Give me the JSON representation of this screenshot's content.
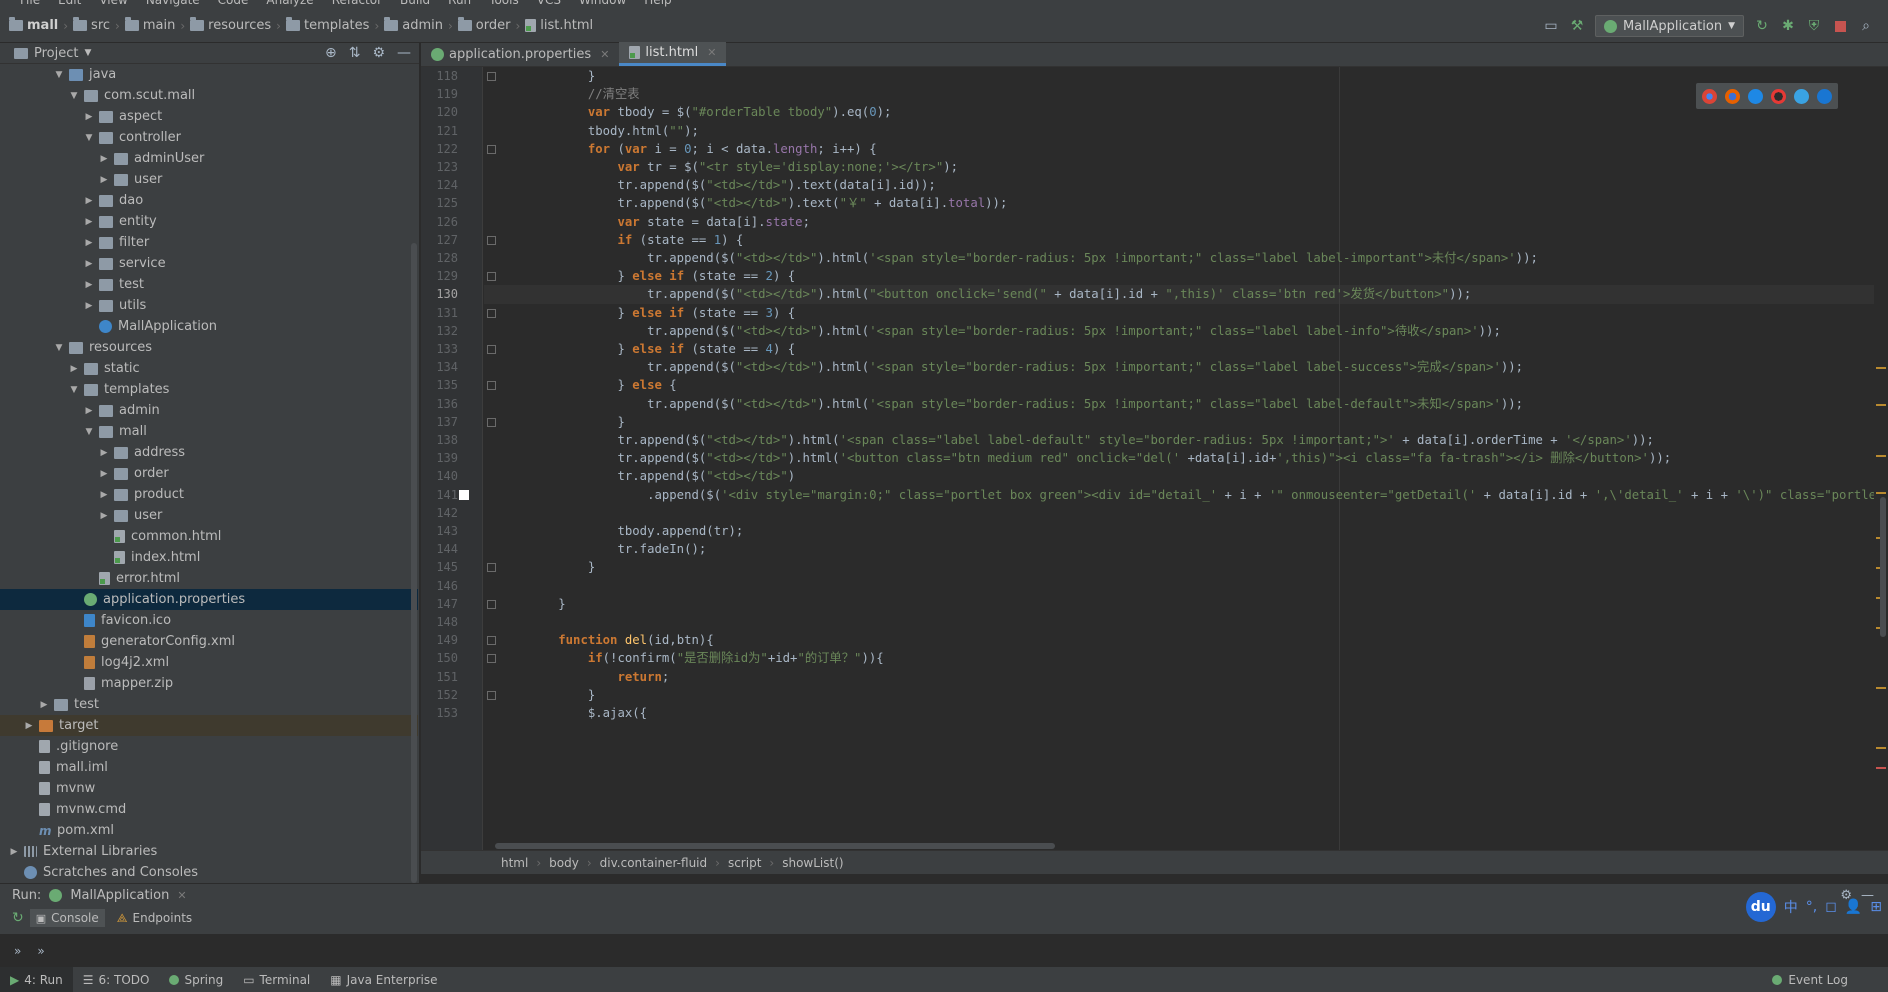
{
  "menu": [
    "File",
    "Edit",
    "View",
    "Navigate",
    "Code",
    "Analyze",
    "Refactor",
    "Build",
    "Run",
    "Tools",
    "VCS",
    "Window",
    "Help"
  ],
  "nav": {
    "breadcrumbs": [
      "mall",
      "src",
      "main",
      "resources",
      "templates",
      "admin",
      "order",
      "list.html"
    ],
    "run_config": "MallApplication"
  },
  "project": {
    "title": "Project",
    "tree": [
      {
        "label": "java",
        "depth": 3,
        "arrow": "open",
        "icon": "folder blue"
      },
      {
        "label": "com.scut.mall",
        "depth": 4,
        "arrow": "open",
        "icon": "folder"
      },
      {
        "label": "aspect",
        "depth": 5,
        "arrow": "closed",
        "icon": "folder"
      },
      {
        "label": "controller",
        "depth": 5,
        "arrow": "open",
        "icon": "folder"
      },
      {
        "label": "adminUser",
        "depth": 6,
        "arrow": "closed",
        "icon": "folder"
      },
      {
        "label": "user",
        "depth": 6,
        "arrow": "closed",
        "icon": "folder"
      },
      {
        "label": "dao",
        "depth": 5,
        "arrow": "closed",
        "icon": "folder"
      },
      {
        "label": "entity",
        "depth": 5,
        "arrow": "closed",
        "icon": "folder"
      },
      {
        "label": "filter",
        "depth": 5,
        "arrow": "closed",
        "icon": "folder"
      },
      {
        "label": "service",
        "depth": 5,
        "arrow": "closed",
        "icon": "folder"
      },
      {
        "label": "test",
        "depth": 5,
        "arrow": "closed",
        "icon": "folder"
      },
      {
        "label": "utils",
        "depth": 5,
        "arrow": "closed",
        "icon": "folder"
      },
      {
        "label": "MallApplication",
        "depth": 5,
        "arrow": "none",
        "icon": "cls"
      },
      {
        "label": "resources",
        "depth": 3,
        "arrow": "open",
        "icon": "folder"
      },
      {
        "label": "static",
        "depth": 4,
        "arrow": "closed",
        "icon": "folder"
      },
      {
        "label": "templates",
        "depth": 4,
        "arrow": "open",
        "icon": "folder"
      },
      {
        "label": "admin",
        "depth": 5,
        "arrow": "closed",
        "icon": "folder"
      },
      {
        "label": "mall",
        "depth": 5,
        "arrow": "open",
        "icon": "folder"
      },
      {
        "label": "address",
        "depth": 6,
        "arrow": "closed",
        "icon": "folder"
      },
      {
        "label": "order",
        "depth": 6,
        "arrow": "closed",
        "icon": "folder"
      },
      {
        "label": "product",
        "depth": 6,
        "arrow": "closed",
        "icon": "folder"
      },
      {
        "label": "user",
        "depth": 6,
        "arrow": "closed",
        "icon": "folder"
      },
      {
        "label": "common.html",
        "depth": 6,
        "arrow": "none",
        "icon": "file html"
      },
      {
        "label": "index.html",
        "depth": 6,
        "arrow": "none",
        "icon": "file html"
      },
      {
        "label": "error.html",
        "depth": 5,
        "arrow": "none",
        "icon": "file html"
      },
      {
        "label": "application.properties",
        "depth": 4,
        "arrow": "none",
        "icon": "spring",
        "selected": true
      },
      {
        "label": "favicon.ico",
        "depth": 4,
        "arrow": "none",
        "icon": "file ico"
      },
      {
        "label": "generatorConfig.xml",
        "depth": 4,
        "arrow": "none",
        "icon": "file xml"
      },
      {
        "label": "log4j2.xml",
        "depth": 4,
        "arrow": "none",
        "icon": "file xml"
      },
      {
        "label": "mapper.zip",
        "depth": 4,
        "arrow": "none",
        "icon": "file zip"
      },
      {
        "label": "test",
        "depth": 2,
        "arrow": "closed",
        "icon": "folder"
      },
      {
        "label": "target",
        "depth": 1,
        "arrow": "closed",
        "icon": "folder orange",
        "excluded": true
      },
      {
        "label": ".gitignore",
        "depth": 1,
        "arrow": "none",
        "icon": "file"
      },
      {
        "label": "mall.iml",
        "depth": 1,
        "arrow": "none",
        "icon": "file"
      },
      {
        "label": "mvnw",
        "depth": 1,
        "arrow": "none",
        "icon": "file"
      },
      {
        "label": "mvnw.cmd",
        "depth": 1,
        "arrow": "none",
        "icon": "file"
      },
      {
        "label": "pom.xml",
        "depth": 1,
        "arrow": "none",
        "icon": "maven"
      },
      {
        "label": "External Libraries",
        "depth": 0,
        "arrow": "closed",
        "icon": "lib"
      },
      {
        "label": "Scratches and Consoles",
        "depth": 0,
        "arrow": "none",
        "icon": "scratch"
      }
    ]
  },
  "tabs": [
    {
      "label": "application.properties",
      "icon": "spring",
      "active": false
    },
    {
      "label": "list.html",
      "icon": "html",
      "active": true
    }
  ],
  "code": {
    "first_line": 118,
    "current_line": 130,
    "lines": [
      "            }",
      "            //清空表",
      "            var tbody = $(\"#orderTable tbody\").eq(0);",
      "            tbody.html(\"\");",
      "            for (var i = 0; i < data.length; i++) {",
      "                var tr = $(\"<tr style='display:none;'></tr>\");",
      "                tr.append($(\"<td></td>\").text(data[i].id));",
      "                tr.append($(\"<td></td>\").text(\"￥\" + data[i].total));",
      "                var state = data[i].state;",
      "                if (state == 1) {",
      "                    tr.append($(\"<td></td>\").html('<span style=\"border-radius: 5px !important;\" class=\"label label-important\">未付</span>'));",
      "                } else if (state == 2) {",
      "                    tr.append($(\"<td></td>\").html(\"<button onclick='send(\" + data[i].id + \",this)' class='btn red'>发货</button>\"));",
      "                } else if (state == 3) {",
      "                    tr.append($(\"<td></td>\").html('<span style=\"border-radius: 5px !important;\" class=\"label label-info\">待收</span>'));",
      "                } else if (state == 4) {",
      "                    tr.append($(\"<td></td>\").html('<span style=\"border-radius: 5px !important;\" class=\"label label-success\">完成</span>'));",
      "                } else {",
      "                    tr.append($(\"<td></td>\").html('<span style=\"border-radius: 5px !important;\" class=\"label label-default\">未知</span>'));",
      "                }",
      "                tr.append($(\"<td></td>\").html('<span class=\"label label-default\" style=\"border-radius: 5px !important;\">' + data[i].orderTime + '</span>'));",
      "                tr.append($(\"<td></td>\").html('<button class=\"btn medium red\" onclick=\"del(' +data[i].id+',this)\"><i class=\"fa fa-trash\"></i> 删除</button>'));",
      "                tr.append($(\"<td></td>\")",
      "                    .append($('<div style=\"margin:0;\" class=\"portlet box green\"><div id=\"detail_' + i + '\" onmouseenter=\"getDetail(' + data[i].id + ',\\'detail_' + i + '\\')\" class=\"portlet-title\"><div c",
      "",
      "                tbody.append(tr);",
      "                tr.fadeIn();",
      "            }",
      "",
      "        }",
      "",
      "        function del(id,btn){",
      "            if(!confirm(\"是否删除id为\"+id+\"的订单？\")){",
      "                return;",
      "            }",
      "            $.ajax({"
    ]
  },
  "editor_breadcrumbs": [
    "html",
    "body",
    "div.container-fluid",
    "script",
    "showList()"
  ],
  "run": {
    "label": "Run:",
    "config": "MallApplication",
    "tabs": [
      "Console",
      "Endpoints"
    ]
  },
  "ime": {
    "brand": "du",
    "items": [
      "中",
      "°,",
      "◻",
      "👤",
      "⊞"
    ]
  },
  "status": {
    "items": [
      "4: Run",
      "6: TODO",
      "Spring",
      "Terminal",
      "Java Enterprise"
    ],
    "event_log": "Event Log"
  }
}
